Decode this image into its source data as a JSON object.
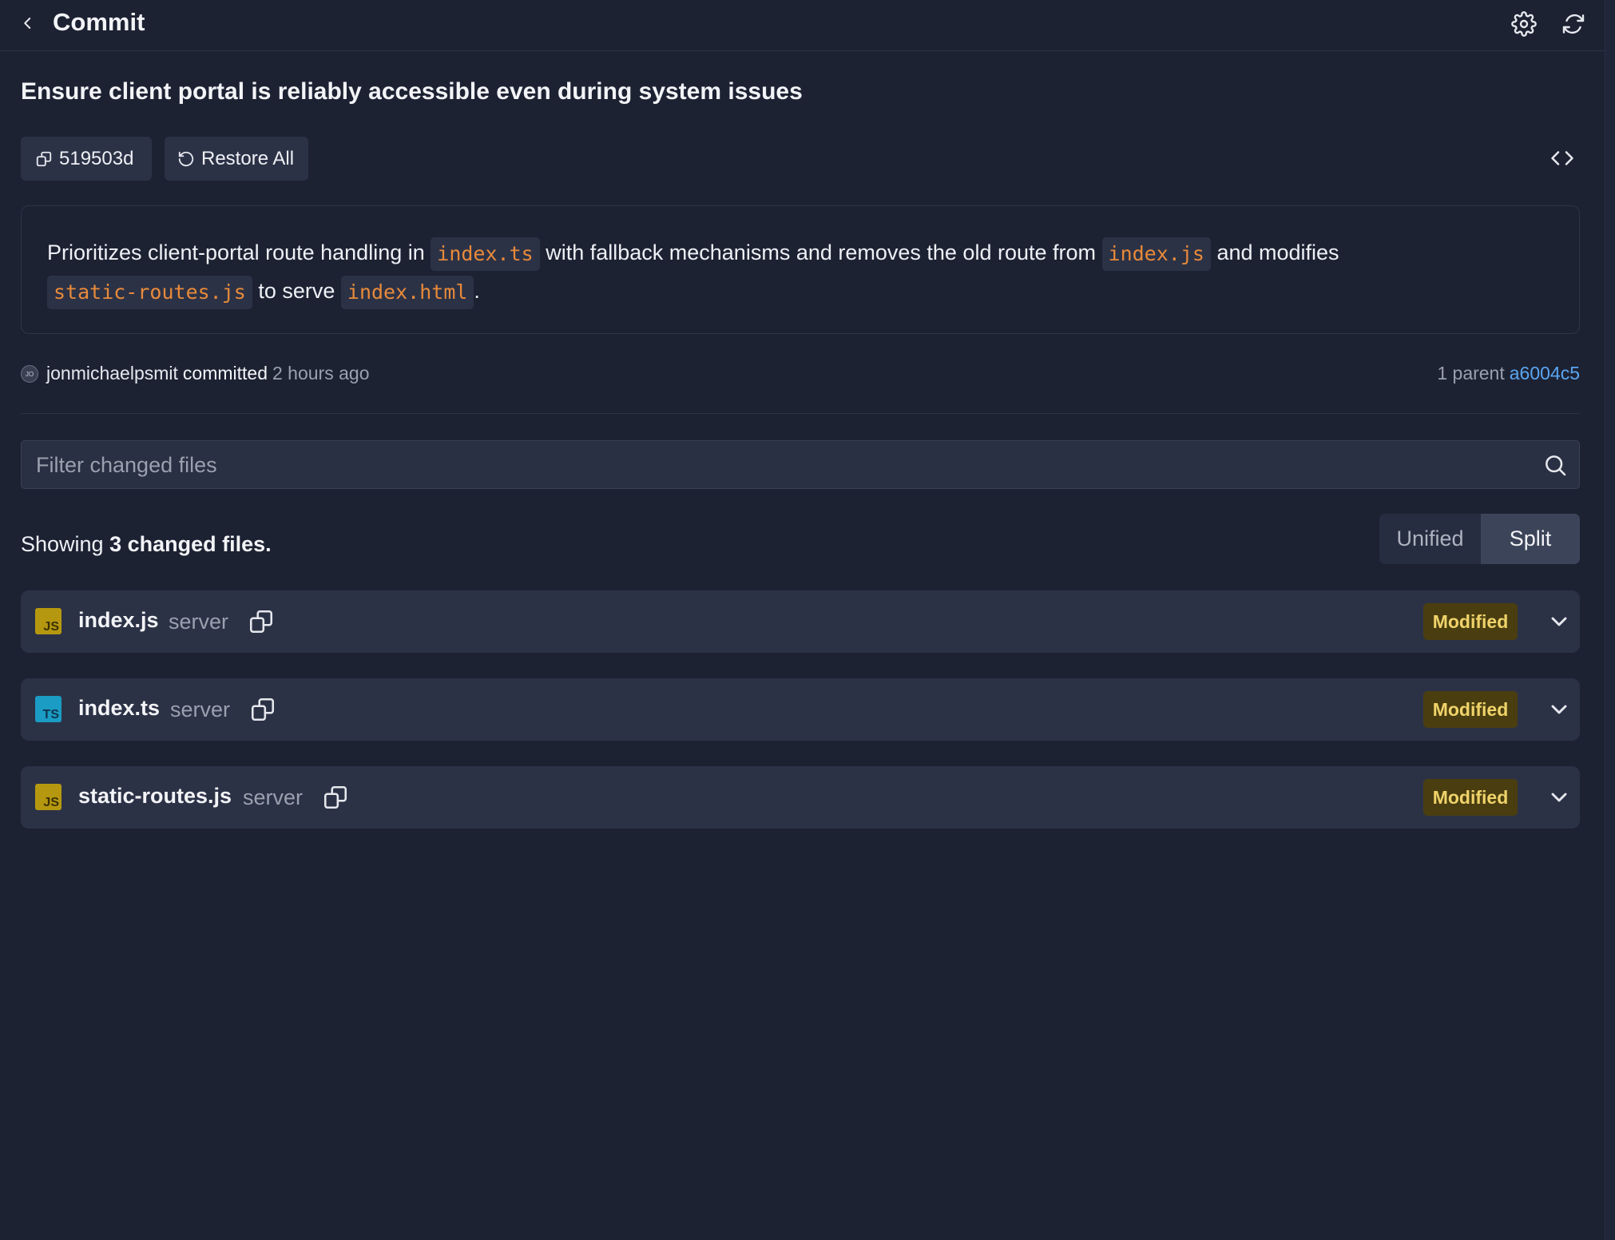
{
  "header": {
    "title": "Commit"
  },
  "commit": {
    "title": "Ensure client portal is reliably accessible even during system issues",
    "sha_short": "519503d",
    "restore_label": "Restore All",
    "description": {
      "t1": "Prioritizes client-portal route handling in",
      "c1": "index.ts",
      "t2": "with fallback mechanisms and removes the old route from",
      "c2": "index.js",
      "t3": "and modifies",
      "c3": "static-routes.js",
      "t4": "to serve",
      "c4": "index.html",
      "t5": "."
    },
    "avatar_initials": "JO",
    "author": "jonmichaelpsmit",
    "verb": "committed",
    "time": "2 hours ago",
    "parent_label": "1 parent",
    "parent_hash": "a6004c5"
  },
  "filter": {
    "placeholder": "Filter changed files"
  },
  "summary": {
    "prefix": "Showing",
    "count_text": "3 changed files."
  },
  "view_toggle": {
    "unified": "Unified",
    "split": "Split",
    "selected": "Split"
  },
  "files": [
    {
      "name": "index.js",
      "dir": "server",
      "type": "JS",
      "status": "Modified",
      "icon_color": "#b5980f",
      "icon_text_color": "#3a2f05"
    },
    {
      "name": "index.ts",
      "dir": "server",
      "type": "TS",
      "status": "Modified",
      "icon_color": "#1a9cc4",
      "icon_text_color": "#0e3550"
    },
    {
      "name": "static-routes.js",
      "dir": "server",
      "type": "JS",
      "status": "Modified",
      "icon_color": "#b5980f",
      "icon_text_color": "#3a2f05"
    }
  ],
  "colors": {
    "background": "#1d2233",
    "panel": "#2c3246",
    "link": "#5aa6f2",
    "code_text": "#e88a3a",
    "badge_bg": "#4a3e10",
    "badge_text": "#f0d36a"
  }
}
